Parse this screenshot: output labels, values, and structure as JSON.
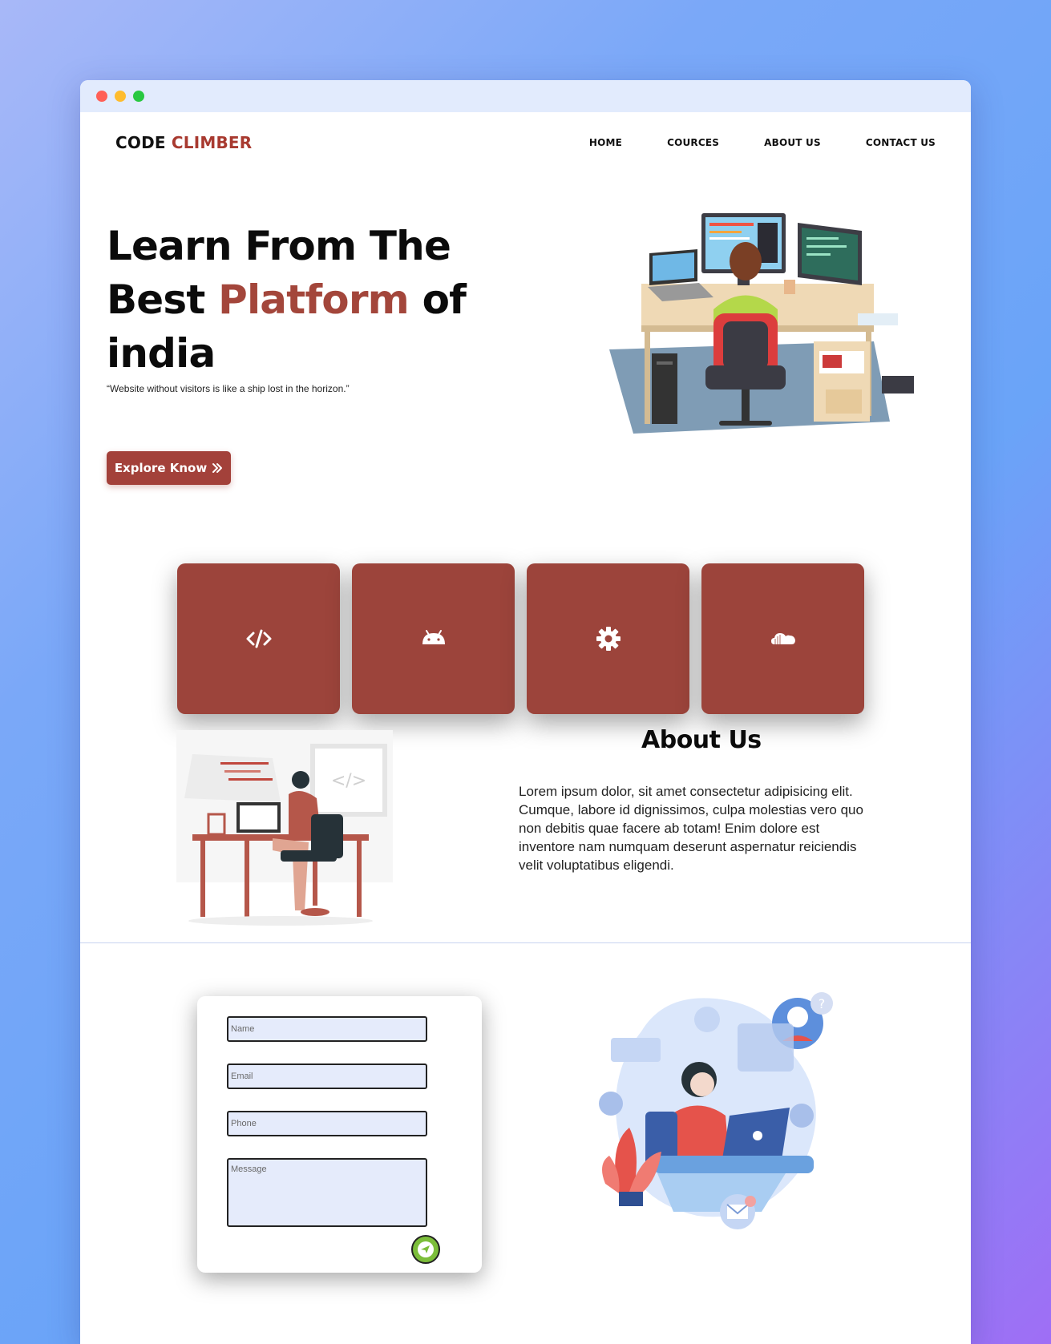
{
  "colors": {
    "accent": "#a3413a",
    "card": "#9c443b",
    "form_field": "#e5ebfb",
    "send": "#7cbe3a"
  },
  "brand": {
    "part1": "CODE",
    "part2": "CLIMBER"
  },
  "nav": {
    "home": "HOME",
    "courses": "COURCES",
    "about": "ABOUT US",
    "contact": "CONTACT US"
  },
  "hero": {
    "line1": "Learn From The",
    "line2_pre": "Best ",
    "line2_accent": "Platform",
    "line2_post": " of",
    "line3": "india",
    "quote": "“Website without visitors is like a ship lost in the horizon.”",
    "cta_label": "Explore Know"
  },
  "features": [
    {
      "icon": "code-icon"
    },
    {
      "icon": "android-icon"
    },
    {
      "icon": "gear-icon"
    },
    {
      "icon": "cloud-icon"
    }
  ],
  "about": {
    "title": "About Us",
    "text": "Lorem ipsum dolor, sit amet consectetur adipisicing elit. Cumque, labore id dignissimos, culpa molestias vero quo non debitis quae facere ab totam! Enim dolore est inventore nam numquam deserunt aspernatur reiciendis velit voluptatibus eligendi."
  },
  "contact_form": {
    "name_placeholder": "Name",
    "email_placeholder": "Email",
    "phone_placeholder": "Phone",
    "message_placeholder": "Message",
    "send_icon": "send-icon"
  }
}
